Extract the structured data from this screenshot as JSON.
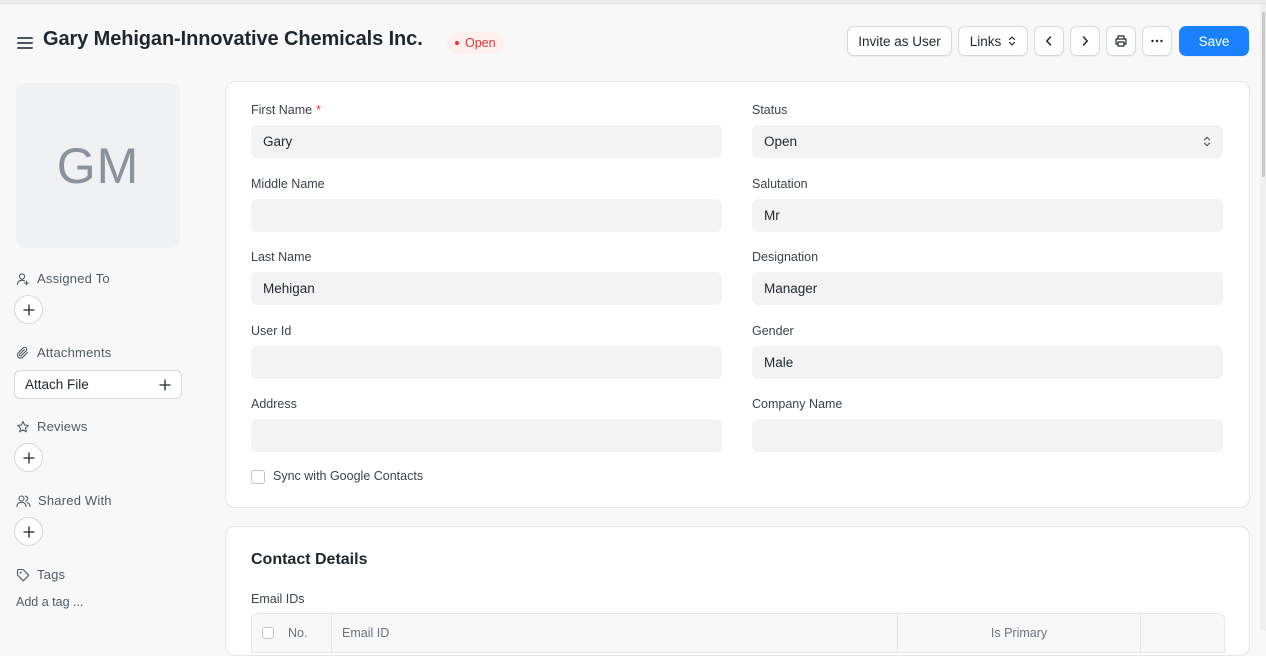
{
  "header": {
    "title": "Gary Mehigan-Innovative Chemicals Inc.",
    "status": "Open",
    "invite_label": "Invite as User",
    "links_label": "Links",
    "save_label": "Save"
  },
  "sidebar": {
    "avatar_initials": "GM",
    "assigned_to": "Assigned To",
    "attachments": "Attachments",
    "attach_file": "Attach File",
    "reviews": "Reviews",
    "shared_with": "Shared With",
    "tags": "Tags",
    "add_tag": "Add a tag ..."
  },
  "form": {
    "first_name": {
      "label": "First Name",
      "required": "*",
      "value": "Gary"
    },
    "middle_name": {
      "label": "Middle Name",
      "value": ""
    },
    "last_name": {
      "label": "Last Name",
      "value": "Mehigan"
    },
    "user_id": {
      "label": "User Id",
      "value": ""
    },
    "address": {
      "label": "Address",
      "value": ""
    },
    "status": {
      "label": "Status",
      "value": "Open"
    },
    "salutation": {
      "label": "Salutation",
      "value": "Mr"
    },
    "designation": {
      "label": "Designation",
      "value": "Manager"
    },
    "gender": {
      "label": "Gender",
      "value": "Male"
    },
    "company_name": {
      "label": "Company Name",
      "value": ""
    },
    "sync_google": "Sync with Google Contacts"
  },
  "contact_details": {
    "title": "Contact Details",
    "email_ids_label": "Email IDs",
    "columns": [
      "No.",
      "Email ID",
      "Is Primary"
    ]
  },
  "colors": {
    "primary": "#1a82ff",
    "status_red": "#e03636"
  }
}
